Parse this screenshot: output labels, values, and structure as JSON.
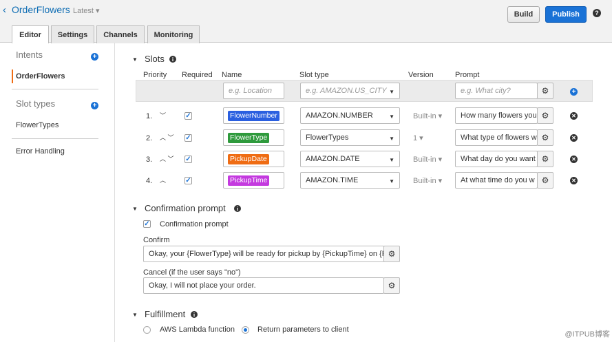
{
  "header": {
    "back_icon": "chevron-left-icon",
    "bot_name": "OrderFlowers",
    "version_label": "Latest ▾",
    "build_label": "Build",
    "publish_label": "Publish",
    "help": "?"
  },
  "tabs": [
    "Editor",
    "Settings",
    "Channels",
    "Monitoring"
  ],
  "sidebar": {
    "intents_heading": "Intents",
    "intents": [
      "OrderFlowers"
    ],
    "slot_types_heading": "Slot types",
    "slot_types": [
      "FlowerTypes"
    ],
    "error_handling": "Error Handling",
    "add_symbol": "+"
  },
  "slots": {
    "title": "Slots",
    "columns": {
      "priority": "Priority",
      "required": "Required",
      "name": "Name",
      "slot_type": "Slot type",
      "version": "Version",
      "prompt": "Prompt"
    },
    "new_row": {
      "name_placeholder": "e.g. Location",
      "type_placeholder": "e.g. AMAZON.US_CITY",
      "prompt_placeholder": "e.g. What city?"
    },
    "rows": [
      {
        "priority": "1.",
        "arrows": "﹀",
        "name": "FlowerNumber",
        "color": "#2a5fe0",
        "type": "AMAZON.NUMBER",
        "version": "Built-in ▾",
        "prompt": "How many flowers you"
      },
      {
        "priority": "2.",
        "arrows": "︿ ﹀",
        "name": "FlowerType",
        "color": "#2e9a3c",
        "type": "FlowerTypes",
        "version": "1 ▾",
        "prompt": "What type of flowers w"
      },
      {
        "priority": "3.",
        "arrows": "︿ ﹀",
        "name": "PickupDate",
        "color": "#ef6c13",
        "type": "AMAZON.DATE",
        "version": "Built-in ▾",
        "prompt": "What day do you want"
      },
      {
        "priority": "4.",
        "arrows": "︿",
        "name": "PickupTime",
        "color": "#c43adf",
        "type": "AMAZON.TIME",
        "version": "Built-in ▾",
        "prompt": "At what time do you w"
      }
    ]
  },
  "confirmation": {
    "title": "Confirmation prompt",
    "checkbox_label": "Confirmation prompt",
    "confirm_label": "Confirm",
    "confirm_value": "Okay, your {FlowerType} will be ready for pickup by {PickupTime} on {Pi",
    "cancel_label": "Cancel (if the user says \"no\")",
    "cancel_value": "Okay, I will not place your order."
  },
  "fulfillment": {
    "title": "Fulfillment",
    "option_lambda": "AWS Lambda function",
    "option_return": "Return parameters to client"
  },
  "watermark": "@ITPUB博客"
}
